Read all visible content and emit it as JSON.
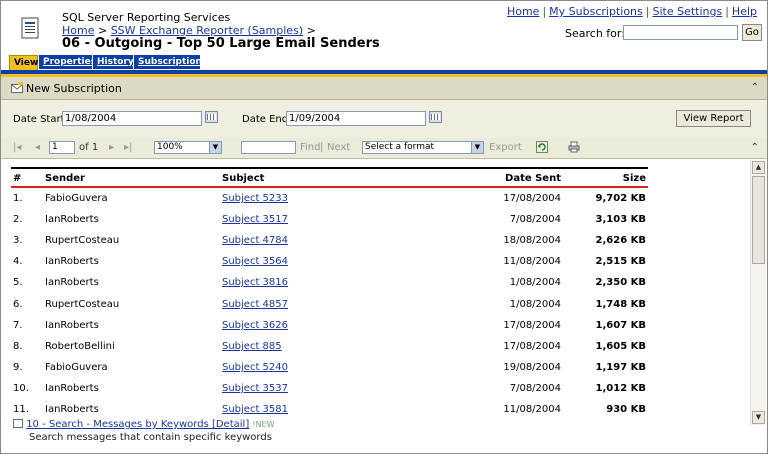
{
  "header": {
    "service_title": "SQL Server Reporting Services",
    "breadcrumb_home": "Home",
    "breadcrumb_sep": ">",
    "breadcrumb_folder": "SSW Exchange Reporter (Samples)",
    "report_title": "06 - Outgoing - Top 50 Large Email Senders",
    "links": [
      "Home",
      "My Subscriptions",
      "Site Settings",
      "Help"
    ],
    "link_sep": "|",
    "search_label": "Search for:",
    "search_value": "",
    "go_label": "Go"
  },
  "tabs": [
    "View",
    "Properties",
    "History",
    "Subscriptions"
  ],
  "active_tab": "View",
  "subscription_bar": {
    "label": "New Subscription"
  },
  "params": {
    "date_start_label": "Date Start",
    "date_start_value": "1/08/2004",
    "date_end_label": "Date End",
    "date_end_value": "1/09/2004",
    "view_report_label": "View Report"
  },
  "toolbar": {
    "page_value": "1",
    "of_label": "of 1",
    "zoom_value": "100%",
    "find_label": "Find",
    "find_sep": "|",
    "next_label": "Next",
    "format_value": "Select a format",
    "export_label": "Export"
  },
  "table": {
    "columns": [
      "#",
      "Sender",
      "Subject",
      "Date Sent",
      "Size"
    ],
    "rows": [
      [
        "1.",
        "FabioGuvera",
        "Subject 5233",
        "17/08/2004",
        "9,702 KB"
      ],
      [
        "2.",
        "IanRoberts",
        "Subject 3517",
        "7/08/2004",
        "3,103 KB"
      ],
      [
        "3.",
        "RupertCosteau",
        "Subject 4784",
        "18/08/2004",
        "2,626 KB"
      ],
      [
        "4.",
        "IanRoberts",
        "Subject 3564",
        "11/08/2004",
        "2,515 KB"
      ],
      [
        "5.",
        "IanRoberts",
        "Subject 3816",
        "1/08/2004",
        "2,350 KB"
      ],
      [
        "6.",
        "RupertCosteau",
        "Subject 4857",
        "1/08/2004",
        "1,748 KB"
      ],
      [
        "7.",
        "IanRoberts",
        "Subject 3626",
        "17/08/2004",
        "1,607 KB"
      ],
      [
        "8.",
        "RobertoBellini",
        "Subject 885",
        "17/08/2004",
        "1,605 KB"
      ],
      [
        "9.",
        "FabioGuvera",
        "Subject 5240",
        "19/08/2004",
        "1,197 KB"
      ],
      [
        "10.",
        "IanRoberts",
        "Subject 3537",
        "7/08/2004",
        "1,012 KB"
      ],
      [
        "11.",
        "IanRoberts",
        "Subject 3581",
        "11/08/2004",
        "930 KB"
      ]
    ]
  },
  "below": {
    "link_text": "10 - Search - Messages by Keywords [Detail]",
    "new_badge": "!NEW",
    "description": "Search messages that contain specific keywords"
  },
  "colors": {
    "tab_active": "#f0c020",
    "tab_inactive": "#0a3ea8",
    "link": "#1a34a8",
    "header_rule": "#e02020"
  }
}
